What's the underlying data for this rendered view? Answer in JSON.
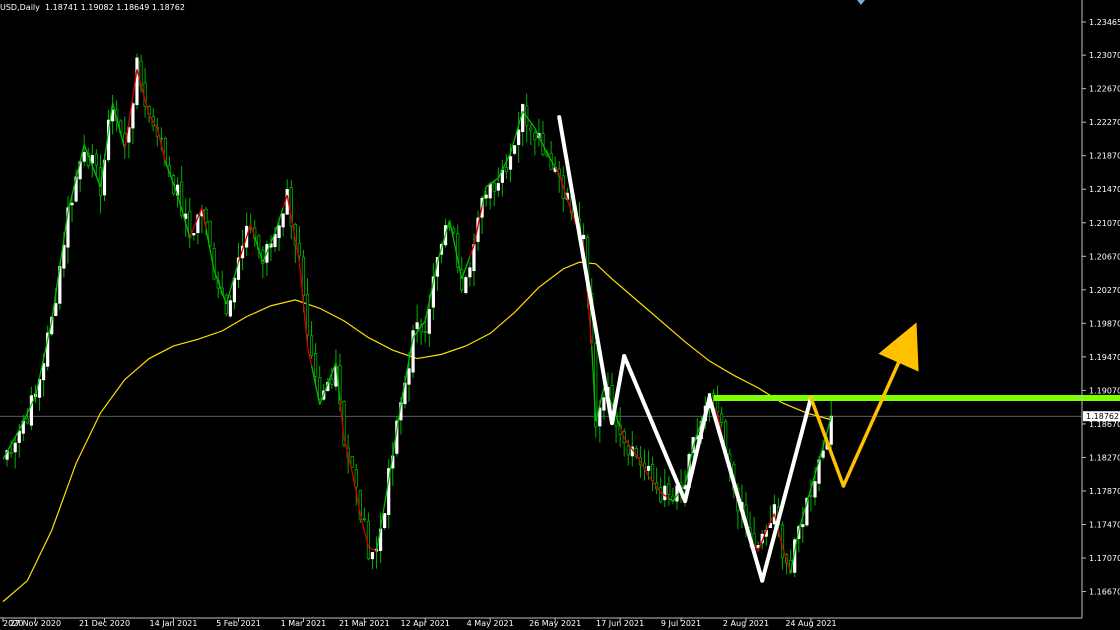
{
  "header": {
    "symbol": "USD,Daily",
    "ohlc": "1.18741 1.19082 1.18649 1.18762"
  },
  "colors": {
    "background": "#000000",
    "axis": "#c0c0c0",
    "candle": "#ffffff",
    "wick": "#00b000",
    "ma_fast_up": "#00c000",
    "ma_fast_down": "#d00000",
    "ma_slow": "#ffe000",
    "wave": "#ffffff",
    "resistance": "#7fff00",
    "projection": "#ffc000",
    "price_line": "#808080"
  },
  "chart_data": {
    "type": "candlestick",
    "symbol": "USD,Daily",
    "last_price": "1.18762",
    "y_ticks": [
      "1.23465",
      "1.23070",
      "1.22670",
      "1.22270",
      "1.21870",
      "1.21470",
      "1.21070",
      "1.20670",
      "1.20270",
      "1.19870",
      "1.19470",
      "1.19070",
      "1.18670",
      "1.18270",
      "1.17870",
      "1.17470",
      "1.17070",
      "1.16670"
    ],
    "ylim": [
      1.1645,
      1.2368
    ],
    "x_ticks": [
      {
        "label": "2020",
        "day": 0
      },
      {
        "label": "27 Nov 2020",
        "day": 8
      },
      {
        "label": "21 Dec 2020",
        "day": 25
      },
      {
        "label": "14 Jan 2021",
        "day": 42
      },
      {
        "label": "5 Feb 2021",
        "day": 58
      },
      {
        "label": "1 Mar 2021",
        "day": 74
      },
      {
        "label": "21 Mar 2021",
        "day": 89
      },
      {
        "label": "12 Apr 2021",
        "day": 104
      },
      {
        "label": "4 May 2021",
        "day": 120
      },
      {
        "label": "26 May 2021",
        "day": 136
      },
      {
        "label": "17 Jun 2021",
        "day": 152
      },
      {
        "label": "9 Jul 2021",
        "day": 167
      },
      {
        "label": "2 Aug 2021",
        "day": 183
      },
      {
        "label": "24 Aug 2021",
        "day": 199
      }
    ],
    "price_path": [
      [
        0,
        1.1825
      ],
      [
        4,
        1.186
      ],
      [
        8,
        1.19
      ],
      [
        12,
        1.199
      ],
      [
        16,
        1.212
      ],
      [
        20,
        1.22
      ],
      [
        24,
        1.215
      ],
      [
        27,
        1.225
      ],
      [
        30,
        1.2195
      ],
      [
        33,
        1.229
      ],
      [
        36,
        1.2235
      ],
      [
        38,
        1.222
      ],
      [
        40,
        1.218
      ],
      [
        43,
        1.214
      ],
      [
        46,
        1.209
      ],
      [
        49,
        1.2125
      ],
      [
        52,
        1.205
      ],
      [
        55,
        1.201
      ],
      [
        58,
        1.206
      ],
      [
        61,
        1.2105
      ],
      [
        64,
        1.206
      ],
      [
        67,
        1.2095
      ],
      [
        70,
        1.214
      ],
      [
        73,
        1.206
      ],
      [
        75,
        1.196
      ],
      [
        78,
        1.189
      ],
      [
        80,
        1.1915
      ],
      [
        82,
        1.194
      ],
      [
        84,
        1.185
      ],
      [
        86,
        1.181
      ],
      [
        88,
        1.176
      ],
      [
        90,
        1.172
      ],
      [
        92,
        1.1715
      ],
      [
        95,
        1.18
      ],
      [
        98,
        1.189
      ],
      [
        101,
        1.197
      ],
      [
        104,
        1.199
      ],
      [
        107,
        1.206
      ],
      [
        110,
        1.211
      ],
      [
        113,
        1.204
      ],
      [
        116,
        1.208
      ],
      [
        119,
        1.215
      ],
      [
        122,
        1.216
      ],
      [
        125,
        1.219
      ],
      [
        128,
        1.224
      ],
      [
        131,
        1.222
      ],
      [
        134,
        1.219
      ],
      [
        137,
        1.2165
      ],
      [
        140,
        1.212
      ],
      [
        143,
        1.208
      ],
      [
        145,
        1.196
      ],
      [
        146,
        1.187
      ],
      [
        148,
        1.191
      ],
      [
        150,
        1.189
      ],
      [
        153,
        1.185
      ],
      [
        156,
        1.183
      ],
      [
        159,
        1.1805
      ],
      [
        162,
        1.1785
      ],
      [
        165,
        1.1775
      ],
      [
        168,
        1.1795
      ],
      [
        170,
        1.184
      ],
      [
        172,
        1.187
      ],
      [
        174,
        1.1895
      ],
      [
        176,
        1.188
      ],
      [
        178,
        1.183
      ],
      [
        180,
        1.179
      ],
      [
        182,
        1.176
      ],
      [
        184,
        1.173
      ],
      [
        186,
        1.1715
      ],
      [
        188,
        1.174
      ],
      [
        190,
        1.176
      ],
      [
        192,
        1.172
      ],
      [
        194,
        1.169
      ],
      [
        196,
        1.174
      ],
      [
        199,
        1.179
      ],
      [
        202,
        1.184
      ],
      [
        204,
        1.1876
      ]
    ],
    "ma_fast_down_ranges": [
      [
        31,
        40
      ],
      [
        47,
        50
      ],
      [
        59,
        62
      ],
      [
        70,
        76
      ],
      [
        84,
        92
      ],
      [
        116,
        118
      ],
      [
        137,
        145
      ],
      [
        153,
        164
      ],
      [
        176,
        194
      ]
    ],
    "ma_slow": [
      [
        0,
        1.1655
      ],
      [
        6,
        1.168
      ],
      [
        12,
        1.174
      ],
      [
        18,
        1.182
      ],
      [
        24,
        1.188
      ],
      [
        30,
        1.192
      ],
      [
        36,
        1.1945
      ],
      [
        42,
        1.196
      ],
      [
        48,
        1.1968
      ],
      [
        54,
        1.1978
      ],
      [
        60,
        1.1995
      ],
      [
        66,
        1.2008
      ],
      [
        72,
        1.2015
      ],
      [
        78,
        1.2005
      ],
      [
        84,
        1.199
      ],
      [
        90,
        1.197
      ],
      [
        96,
        1.1955
      ],
      [
        102,
        1.1945
      ],
      [
        108,
        1.195
      ],
      [
        114,
        1.196
      ],
      [
        120,
        1.1975
      ],
      [
        126,
        1.2
      ],
      [
        132,
        1.203
      ],
      [
        138,
        1.2052
      ],
      [
        142,
        1.206
      ],
      [
        146,
        1.2058
      ],
      [
        150,
        1.204
      ],
      [
        156,
        1.2015
      ],
      [
        162,
        1.199
      ],
      [
        168,
        1.1965
      ],
      [
        174,
        1.1942
      ],
      [
        180,
        1.1925
      ],
      [
        186,
        1.191
      ],
      [
        192,
        1.1892
      ],
      [
        198,
        1.188
      ],
      [
        204,
        1.1872
      ]
    ],
    "waves": [
      {
        "name": "down-leg-1",
        "points": [
          [
            137,
            1.2233
          ],
          [
            150,
            1.1868
          ]
        ]
      },
      {
        "name": "correction-1",
        "points": [
          [
            150,
            1.1868
          ],
          [
            153,
            1.1948
          ]
        ]
      },
      {
        "name": "down-leg-2",
        "points": [
          [
            153,
            1.1948
          ],
          [
            168,
            1.1775
          ]
        ]
      },
      {
        "name": "up-leg-1",
        "points": [
          [
            168,
            1.1775
          ],
          [
            174,
            1.1898
          ]
        ]
      },
      {
        "name": "down-leg-3",
        "points": [
          [
            174,
            1.1898
          ],
          [
            187,
            1.168
          ]
        ]
      },
      {
        "name": "up-leg-2",
        "points": [
          [
            187,
            1.168
          ],
          [
            199,
            1.1898
          ]
        ]
      }
    ],
    "resistance_level": 1.1898,
    "resistance_from_day": 175,
    "projection": {
      "pullback_day": 207,
      "pullback_price": 1.1793,
      "arrow_tip_day": 225,
      "arrow_tip_price": 1.1988
    }
  }
}
